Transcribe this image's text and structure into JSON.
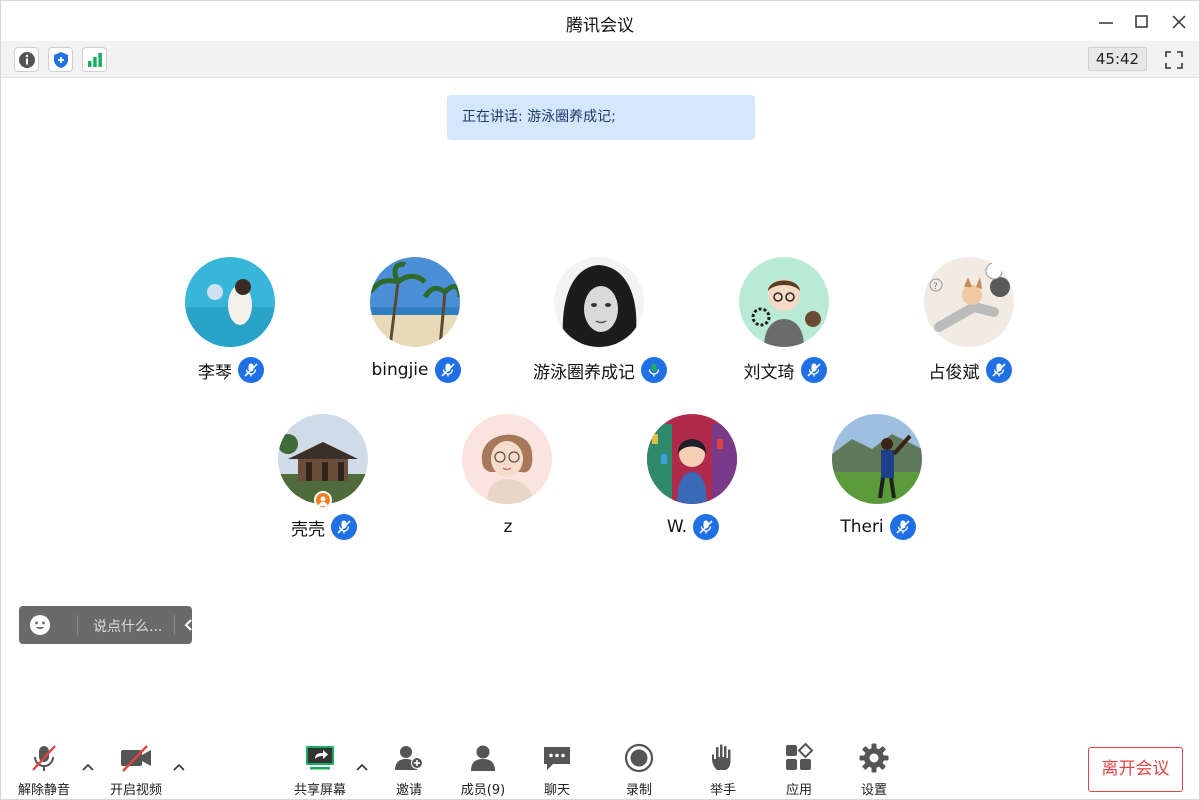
{
  "window": {
    "title": "腾讯会议"
  },
  "infobar": {
    "timer": "45:42"
  },
  "speaking_banner": "正在讲话: 游泳圈养成记;",
  "participants": [
    {
      "name": "李琴",
      "muted": true
    },
    {
      "name": "bingjie",
      "muted": true
    },
    {
      "name": "游泳圈养成记",
      "muted": false,
      "active": true
    },
    {
      "name": "刘文琦",
      "muted": true
    },
    {
      "name": "占俊斌",
      "muted": true
    },
    {
      "name": "壳壳",
      "muted": true,
      "host": true
    },
    {
      "name": "z",
      "muted": false
    },
    {
      "name": "W.",
      "muted": true
    },
    {
      "name": "Theri",
      "muted": true
    }
  ],
  "chat": {
    "placeholder": "说点什么..."
  },
  "toolbar": {
    "unmute": "解除静音",
    "start_video": "开启视频",
    "share_screen": "共享屏幕",
    "invite": "邀请",
    "members": "成员(9)",
    "chat": "聊天",
    "record": "录制",
    "raise_hand": "举手",
    "apps": "应用",
    "settings": "设置",
    "leave": "离开会议"
  },
  "colors": {
    "accent_blue": "#1f6fe5",
    "active_border": "#1aad60",
    "leave_red": "#e04545",
    "banner_bg": "#d5e7fc"
  }
}
